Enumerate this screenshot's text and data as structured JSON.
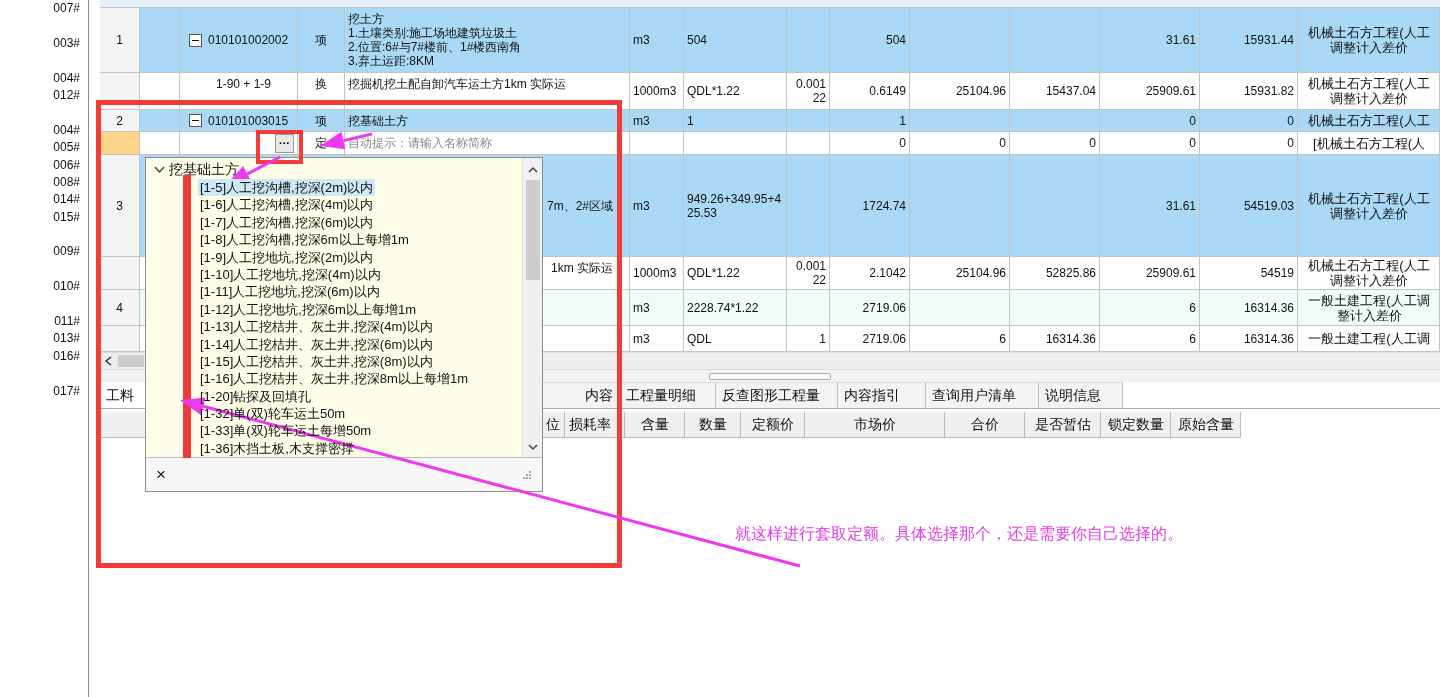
{
  "left_codes": [
    "007#",
    "003#",
    "004#",
    "012#",
    "004#",
    "005#",
    "006#",
    "008#",
    "014#",
    "015#",
    "009#",
    "010#",
    "011#",
    "013#",
    "016#",
    "017#"
  ],
  "table": {
    "rows": [
      {
        "kind": "item",
        "expanded": true,
        "cells": {
          "column_1": "1",
          "column_3": "010101002002",
          "column_4": "项",
          "column_5": "挖土方\n1.土壤类别:施工场地建筑垃圾土\n2.位置:6#与7#楼前、1#楼西南角\n3.弃土运距:8KM",
          "column_6": "m3",
          "column_7": "504",
          "column_9": "504",
          "column_12": "31.61",
          "column_13": "15931.44",
          "column_14": "机械土石方工程(人工调整计入差价"
        }
      },
      {
        "kind": "sub",
        "cells": {
          "column_3": "1-90 + 1-9",
          "column_4": "换",
          "column_5": "挖掘机挖土配自卸汽车运土方1km 实际运",
          "column_6": "1000m3",
          "column_7": "QDL*1.22",
          "column_8": "0.00122",
          "column_9": "0.6149",
          "column_10": "25104.96",
          "column_11": "15437.04",
          "column_12": "25909.61",
          "column_13": "15931.82",
          "column_14": "机械土石方工程(人工调整计入差价"
        }
      },
      {
        "kind": "item",
        "expanded": true,
        "cells": {
          "column_1": "2",
          "column_3": "010101003015",
          "column_4": "项",
          "column_5": "挖基础土方",
          "column_6": "m3",
          "column_7": "1",
          "column_9": "1",
          "column_12": "0",
          "column_13": "0",
          "column_14": "机械土石方工程(人工"
        }
      },
      {
        "kind": "edit",
        "picker_button": "···",
        "placeholder": "自动提示：请输入名称简称",
        "cells": {
          "column_4": "定",
          "column_9": "0",
          "column_10": "0",
          "column_11": "0",
          "column_12": "0",
          "column_13": "0",
          "column_14": "[机械土石方工程(人"
        }
      },
      {
        "kind": "item",
        "cells": {
          "column_1": "3",
          "column_5": "7m、2#区域",
          "column_6": "m3",
          "column_7": "949.26+349.95+425.53",
          "column_9": "1724.74",
          "column_12": "31.61",
          "column_13": "54519.03",
          "column_14": "机械土石方工程(人工调整计入差价"
        }
      },
      {
        "kind": "sub",
        "cells": {
          "column_5": "1km 实际运",
          "column_6": "1000m3",
          "column_7": "QDL*1.22",
          "column_8": "0.00122",
          "column_9": "2.1042",
          "column_10": "25104.96",
          "column_11": "52825.86",
          "column_12": "25909.61",
          "column_13": "54519",
          "column_14": "机械土石方工程(人工调整计入差价"
        }
      },
      {
        "kind": "item-alt",
        "cells": {
          "column_1": "4",
          "column_6": "m3",
          "column_7": "2228.74*1.22",
          "column_9": "2719.06",
          "column_12": "6",
          "column_13": "16314.36",
          "column_14": "一般土建工程(人工调整计入差价"
        }
      },
      {
        "kind": "sub",
        "cells": {
          "column_6": "m3",
          "column_7": "QDL",
          "column_8": "1",
          "column_9": "2719.06",
          "column_10": "6",
          "column_11": "16314.36",
          "column_12": "6",
          "column_13": "16314.36",
          "column_14": "一般土建工程(人工调"
        }
      }
    ]
  },
  "bottom_tabs": [
    {
      "label": "工料",
      "selected": true
    },
    {
      "label": "内容",
      "selected": false
    },
    {
      "label": "工程量明细",
      "selected": false
    },
    {
      "label": "反查图形工程量",
      "selected": false
    },
    {
      "label": "内容指引",
      "selected": false
    },
    {
      "label": "查询用户清单",
      "selected": false
    },
    {
      "label": "说明信息",
      "selected": false
    }
  ],
  "bottom_columns": [
    "位",
    "损耗率",
    "含量",
    "数量",
    "定额价",
    "市场价",
    "合价",
    "是否暂估",
    "锁定数量",
    "原始含量"
  ],
  "popup": {
    "root": {
      "label": "挖基础土方",
      "expanded": true
    },
    "items": [
      {
        "label": "[1-5]人工挖沟槽,挖深(2m)以内",
        "selected": true
      },
      {
        "label": "[1-6]人工挖沟槽,挖深(4m)以内",
        "selected": false
      },
      {
        "label": "[1-7]人工挖沟槽,挖深(6m)以内",
        "selected": false
      },
      {
        "label": "[1-8]人工挖沟槽,挖深6m以上每增1m",
        "selected": false
      },
      {
        "label": "[1-9]人工挖地坑,挖深(2m)以内",
        "selected": false
      },
      {
        "label": "[1-10]人工挖地坑,挖深(4m)以内",
        "selected": false
      },
      {
        "label": "[1-11]人工挖地坑,挖深(6m)以内",
        "selected": false
      },
      {
        "label": "[1-12]人工挖地坑,挖深6m以上每增1m",
        "selected": false
      },
      {
        "label": "[1-13]人工挖桔井、灰土井,挖深(4m)以内",
        "selected": false
      },
      {
        "label": "[1-14]人工挖桔井、灰土井,挖深(6m)以内",
        "selected": false
      },
      {
        "label": "[1-15]人工挖桔井、灰土井,挖深(8m)以内",
        "selected": false
      },
      {
        "label": "[1-16]人工挖桔井、灰土井,挖深8m以上每增1m",
        "selected": false
      },
      {
        "label": "[1-20]钻探及回填孔",
        "selected": false
      },
      {
        "label": "[1-32]单(双)轮车运土50m",
        "selected": false
      },
      {
        "label": "[1-33]单(双)轮车运土每增50m",
        "selected": false
      },
      {
        "label": "[1-36]木挡土板,木支撑密撑",
        "selected": false
      }
    ],
    "close": "×"
  },
  "annotation": "就这样进行套取定额。具体选择那个，还是需要你自己选择的。"
}
